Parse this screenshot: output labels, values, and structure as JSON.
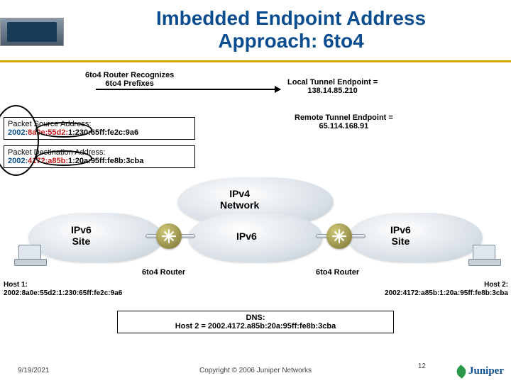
{
  "title_line1": "Imbedded Endpoint Address",
  "title_line2": "Approach: 6to4",
  "recognizes_line1": "6to4 Router Recognizes",
  "recognizes_line2": "6to4 Prefixes",
  "local_ep_line1": "Local Tunnel Endpoint =",
  "local_ep_line2": "138.14.85.210",
  "remote_ep_line1": "Remote Tunnel Endpoint =",
  "remote_ep_line2": "65.114.168.91",
  "pkt_src_label": "Packet Source Address:",
  "pkt_src_p1": "2002:",
  "pkt_src_p2": "8a0e:55d2:",
  "pkt_src_p3": "1:230:65ff:fe2c:9a6",
  "pkt_dst_label": "Packet Destination Address:",
  "pkt_dst_p1": "2002:",
  "pkt_dst_p2": "4172:a85b:",
  "pkt_dst_p3": "1:20a:95ff:fe8b:3cba",
  "cloud_top_line1": "IPv4",
  "cloud_top_line2": "Network",
  "cloud_left_line1": "IPv6",
  "cloud_left_line2": "Site",
  "cloud_mid": "IPv6",
  "cloud_right_line1": "IPv6",
  "cloud_right_line2": "Site",
  "router_label_l": "6to4 Router",
  "router_label_r": "6to4 Router",
  "host1_line1": "Host 1:",
  "host1_line2": "2002:8a0e:55d2:1:230:65ff:fe2c:9a6",
  "host2_line1": "Host 2:",
  "host2_line2": "2002:4172:a85b:1:20a:95ff:fe8b:3cba",
  "dns_line1": "DNS:",
  "dns_line2": "Host 2 = 2002.4172.a85b:20a:95ff:fe8b:3cba",
  "footer_date": "9/19/2021",
  "footer_copy": "Copyright © 2006 Juniper Networks",
  "footer_page": "12",
  "logo_text": "Juniper"
}
